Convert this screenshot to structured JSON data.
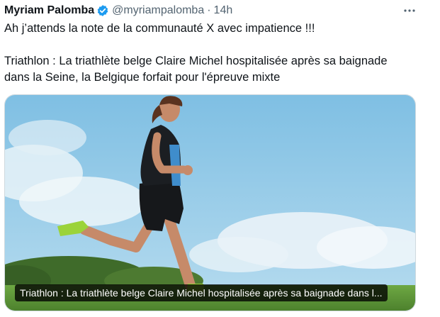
{
  "author": {
    "name": "Myriam Palomba",
    "handle": "@myriampalomba",
    "separator": "·",
    "time": "14h"
  },
  "tweet": {
    "line1": "Ah j’attends la note de la communauté X avec impatience !!!",
    "line2": "Triathlon : La triathlète belge Claire Michel hospitalisée après sa baignade",
    "line3": "dans la Seine, la Belgique forfait pour l'épreuve mixte"
  },
  "media": {
    "caption": "Triathlon : La triathlète belge Claire Michel hospitalisée après sa baignade dans l..."
  },
  "icons": {
    "verified": "verified-badge-icon",
    "more": "more-options-icon"
  },
  "colors": {
    "verified": "#1d9bf0",
    "secondary_text": "#536471",
    "primary_text": "#0f1419",
    "sky": "#8cc8e6",
    "grass": "#5f9a3a"
  }
}
